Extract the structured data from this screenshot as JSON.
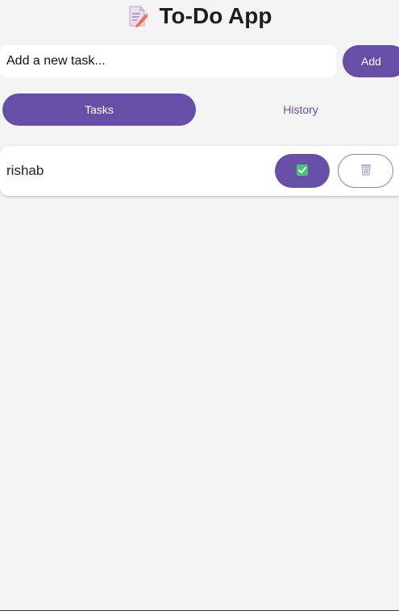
{
  "header": {
    "title": "To-Do App",
    "icon": "memo-icon"
  },
  "new_task": {
    "placeholder": "Add a new task...",
    "value": "",
    "add_label": "Add"
  },
  "tabs": [
    {
      "label": "Tasks",
      "active": true
    },
    {
      "label": "History",
      "active": false
    }
  ],
  "tasks": [
    {
      "text": "rishab",
      "complete_icon": "check-box-icon",
      "delete_icon": "wastebasket-icon"
    }
  ],
  "colors": {
    "accent": "#674ea7",
    "background": "#f4f4f4",
    "card": "#ffffff",
    "check_green": "#4cc17a"
  }
}
